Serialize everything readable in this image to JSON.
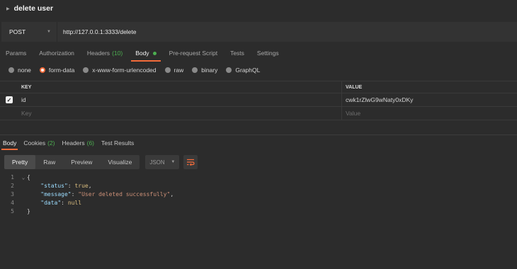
{
  "window": {
    "title": "delete user"
  },
  "request": {
    "method": "POST",
    "url": "http://127.0.0.1:3333/delete"
  },
  "tabs": [
    {
      "label": "Params"
    },
    {
      "label": "Authorization"
    },
    {
      "label": "Headers",
      "count": "(10)"
    },
    {
      "label": "Body",
      "active": true
    },
    {
      "label": "Pre-request Script"
    },
    {
      "label": "Tests"
    },
    {
      "label": "Settings"
    }
  ],
  "body_types": [
    "none",
    "form-data",
    "x-www-form-urlencoded",
    "raw",
    "binary",
    "GraphQL"
  ],
  "body_type_selected": "form-data",
  "kv_table": {
    "key_header": "KEY",
    "value_header": "VALUE",
    "rows": [
      {
        "checked": true,
        "key": "id",
        "value": "cwk1rZlwG9wNaty0xDKy"
      }
    ],
    "key_placeholder": "Key",
    "value_placeholder": "Value"
  },
  "response_tabs": [
    {
      "label": "Body",
      "active": true
    },
    {
      "label": "Cookies",
      "count": "(2)"
    },
    {
      "label": "Headers",
      "count": "(6)"
    },
    {
      "label": "Test Results"
    }
  ],
  "view_modes": [
    "Pretty",
    "Raw",
    "Preview",
    "Visualize"
  ],
  "view_mode_active": "Pretty",
  "format": "JSON",
  "response_lines": [
    "1",
    "2",
    "3",
    "4",
    "5"
  ],
  "response_json": {
    "open": "{",
    "status_key": "\"status\"",
    "status_val": "true",
    "message_key": "\"message\"",
    "message_val": "\"User deleted successfully\"",
    "data_key": "\"data\"",
    "data_val": "null",
    "close": "}"
  },
  "colors": {
    "accent": "#f26b3a",
    "count_green": "#4caf50"
  },
  "icons": [
    "caret-right-icon",
    "chevron-down-icon",
    "checkbox-checked-icon",
    "wrap-lines-icon"
  ]
}
